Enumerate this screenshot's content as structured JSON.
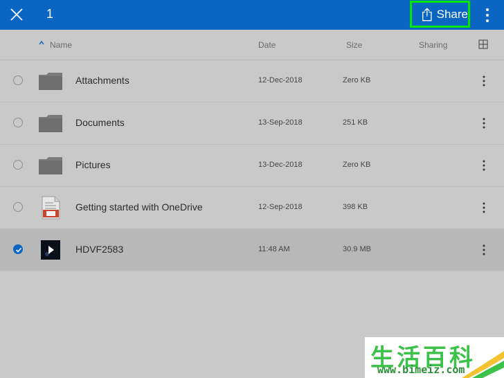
{
  "topbar": {
    "selected_count": "1",
    "share_label": "Share",
    "icons": {
      "close": "close-icon",
      "share": "share-icon",
      "more": "more-vertical-icon"
    },
    "accent_color": "#0a66c2",
    "highlight_color": "#00e600"
  },
  "columns": {
    "name": "Name",
    "date": "Date",
    "size": "Size",
    "sharing": "Sharing",
    "sort_icon": "sort-ascending-icon",
    "view_icon": "grid-view-icon"
  },
  "files": [
    {
      "name": "Attachments",
      "date": "12-Dec-2018",
      "size": "Zero KB",
      "type": "folder",
      "selected": false
    },
    {
      "name": "Documents",
      "date": "13-Sep-2018",
      "size": "251 KB",
      "type": "folder",
      "selected": false
    },
    {
      "name": "Pictures",
      "date": "13-Dec-2018",
      "size": "Zero KB",
      "type": "folder",
      "selected": false
    },
    {
      "name": "Getting started with OneDrive",
      "date": "12-Sep-2018",
      "size": "398 KB",
      "type": "pdf",
      "selected": false
    },
    {
      "name": "HDVF2583",
      "date": "11:48 AM",
      "size": "30.9 MB",
      "type": "video",
      "selected": true
    }
  ],
  "watermark": {
    "chinese": "生活百科",
    "url": "www.bimeiz.com"
  }
}
